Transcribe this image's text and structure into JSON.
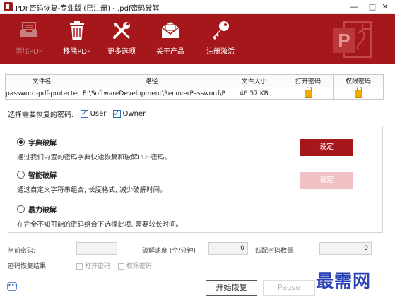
{
  "window": {
    "title": "PDF密码恢复-专业版 (已注册) - .pdf密码破解",
    "minimize_glyph": "—",
    "maximize_glyph": "□",
    "close_glyph": "✕"
  },
  "toolbar": {
    "background": "#a5171b",
    "buttons": [
      {
        "label": "添加PDF",
        "icon": "inbox-tray-icon",
        "enabled": false
      },
      {
        "label": "移除PDF",
        "icon": "trash-icon",
        "enabled": true
      },
      {
        "label": "更多选项",
        "icon": "tools-icon",
        "enabled": true
      },
      {
        "label": "关于产品",
        "icon": "envelope-icon",
        "enabled": true
      },
      {
        "label": "注册激活",
        "icon": "key-icon",
        "enabled": true
      }
    ]
  },
  "file_table": {
    "headers": [
      "文件名",
      "路径",
      "文件大小",
      "打开密码",
      "权限密码"
    ],
    "rows": [
      {
        "filename": "password-pdf-protected.pdf",
        "path": "E:\\SoftwareDevelopment\\RecoverPassword\\PDF Pas:",
        "size": "46.57 KB",
        "open_password": "lock-icon",
        "permission_password": "lock-icon"
      }
    ]
  },
  "password_select": {
    "label": "选择需要恢复的密码:",
    "user_label": "User",
    "user_checked": true,
    "owner_label": "Owner",
    "owner_checked": true
  },
  "modes": [
    {
      "title": "字典破解",
      "desc": "通过我们内置的密码字典快速恢复和破解PDF密码。",
      "selected": true,
      "button": "设定",
      "button_enabled": true
    },
    {
      "title": "智能破解",
      "desc": "通过自定义字符串组合, 长度格式, 减少破解时间。",
      "selected": false,
      "button": "设定",
      "button_enabled": false
    },
    {
      "title": "暴力破解",
      "desc": "在完全不知可能的密码组合下选择此项, 需要较长时间。",
      "selected": false
    }
  ],
  "stats": {
    "current_label": "当前密码:",
    "current_value": "",
    "speed_label": "破解速度 (个/分钟)",
    "speed_value": "0",
    "match_label": "匹配密码数量",
    "match_value": "0",
    "result_label": "密码恢复结果:",
    "result_open": "打开密码",
    "result_perm": "权限密码"
  },
  "actions": {
    "start": "开始恢复",
    "pause": "Pause",
    "stop": ""
  },
  "help_glyph": "•••",
  "watermark": "最需网"
}
